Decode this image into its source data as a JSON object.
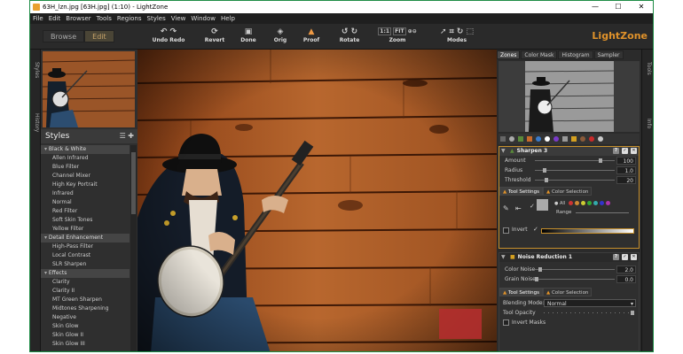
{
  "window": {
    "title": "63H_lzn.jpg [63H.jpg] (1:10) - LightZone",
    "controls": [
      "—",
      "☐",
      "✕"
    ]
  },
  "menu": [
    "File",
    "Edit",
    "Browser",
    "Tools",
    "Regions",
    "Styles",
    "View",
    "Window",
    "Help"
  ],
  "toolbar": {
    "tabs": [
      {
        "label": "Browse",
        "active": false
      },
      {
        "label": "Edit",
        "active": true
      }
    ],
    "buttons": {
      "undoredo": "Undo Redo",
      "revert": "Revert",
      "done": "Done",
      "orig": "Orig",
      "proof": "Proof",
      "rotate": "Rotate",
      "zoom": "Zoom",
      "modes": "Modes"
    },
    "zoom_fit_labels": [
      "1:1",
      "FIT"
    ],
    "logo": "LightZone"
  },
  "left_rail": {
    "tabs": [
      "Styles",
      "History"
    ]
  },
  "styles": {
    "title": "Styles",
    "items": [
      {
        "label": "Black & White",
        "group": true
      },
      {
        "label": "Allen Infrared"
      },
      {
        "label": "Blue Filter"
      },
      {
        "label": "Channel Mixer"
      },
      {
        "label": "High Key Portrait"
      },
      {
        "label": "Infrared"
      },
      {
        "label": "Normal"
      },
      {
        "label": "Red Filter"
      },
      {
        "label": "Soft Skin Tones"
      },
      {
        "label": "Yellow Filter"
      },
      {
        "label": "Detail Enhancement",
        "group": true
      },
      {
        "label": "High-Pass Filter"
      },
      {
        "label": "Local Contrast"
      },
      {
        "label": "SLR Sharpen"
      },
      {
        "label": "Effects",
        "group": true
      },
      {
        "label": "Clarity"
      },
      {
        "label": "Clarity II"
      },
      {
        "label": "MT Green Sharpen"
      },
      {
        "label": "Midtones Sharpening"
      },
      {
        "label": "Negative"
      },
      {
        "label": "Skin Glow"
      },
      {
        "label": "Skin Glow II"
      },
      {
        "label": "Skin Glow III"
      }
    ]
  },
  "right_panel": {
    "tabs": [
      {
        "label": "Zones",
        "active": true
      },
      {
        "label": "Color Mask"
      },
      {
        "label": "Histogram"
      },
      {
        "label": "Sampler"
      }
    ],
    "sharpen": {
      "title": "Sharpen 3",
      "params": [
        {
          "label": "Amount",
          "value": "100",
          "pos": 0.82
        },
        {
          "label": "Radius",
          "value": "1.0",
          "pos": 0.1
        },
        {
          "label": "Threshold",
          "value": "20",
          "pos": 0.12
        }
      ],
      "subtabs": [
        "Tool Settings",
        "Color Selection"
      ],
      "all_label": "All",
      "range_label": "Range",
      "invert_label": "Invert"
    },
    "noise": {
      "title": "Noise Reduction 1",
      "params": [
        {
          "label": "Color Noise",
          "value": "2.0",
          "pos": 0.05
        },
        {
          "label": "Grain Noise",
          "value": "0.0",
          "pos": 0.0
        }
      ],
      "subtabs": [
        "Tool Settings",
        "Color Selection"
      ],
      "blending_label": "Blending Mode:",
      "blending_value": "Normal",
      "opacity_label": "Tool Opacity",
      "invert_label": "Invert Masks"
    }
  },
  "tools_rail": {
    "tabs": [
      "Tools",
      "Info"
    ]
  },
  "colors": {
    "accent": "#e0922a",
    "selected_tool_border": "#c7902c"
  }
}
